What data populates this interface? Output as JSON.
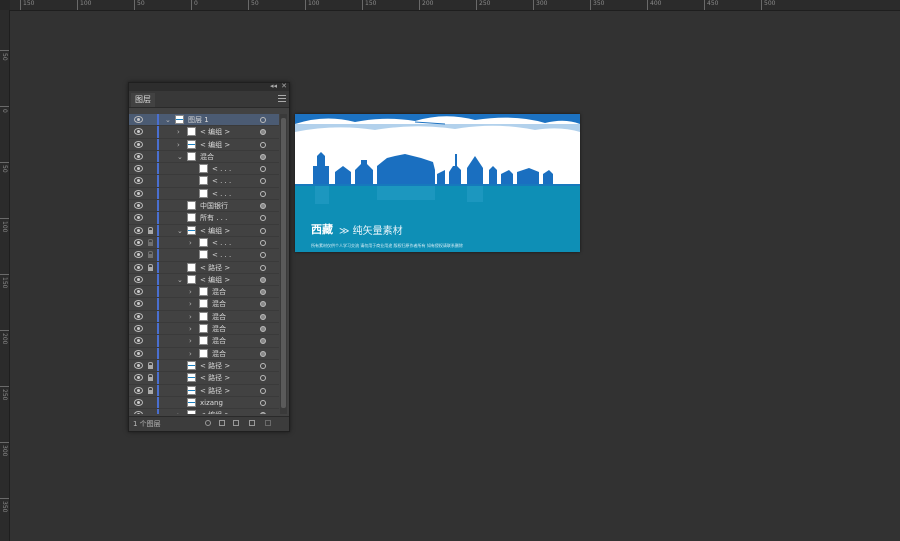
{
  "ruler": {
    "top_labels": [
      "150",
      "100",
      "50",
      "0",
      "50",
      "100",
      "150",
      "200",
      "250",
      "300",
      "350",
      "400",
      "450",
      "500"
    ],
    "left_labels": [
      "50",
      "0",
      "50",
      "100",
      "150",
      "200",
      "250",
      "300",
      "350"
    ]
  },
  "panel": {
    "collapse_glyph": "◂◂",
    "close_glyph": "✕",
    "tab_label": "图层",
    "footer_count": "1 个图层",
    "rows": [
      {
        "name": "图层 1",
        "arrow": "⌄",
        "indent": 0,
        "thumb": "pic",
        "lock": "none",
        "target": "empty",
        "selected": true
      },
      {
        "name": "< 编组 >",
        "arrow": "›",
        "indent": 1,
        "thumb": "white",
        "lock": "none",
        "target": "filled"
      },
      {
        "name": "< 编组 >",
        "arrow": "›",
        "indent": 1,
        "thumb": "pic",
        "lock": "none",
        "target": "empty"
      },
      {
        "name": "混合",
        "arrow": "⌄",
        "indent": 1,
        "thumb": "white",
        "lock": "none",
        "target": "filled"
      },
      {
        "name": "< . . .",
        "arrow": "",
        "indent": 2,
        "thumb": "white",
        "lock": "none",
        "target": "empty"
      },
      {
        "name": "< . . .",
        "arrow": "",
        "indent": 2,
        "thumb": "white",
        "lock": "none",
        "target": "empty"
      },
      {
        "name": "< . . .",
        "arrow": "",
        "indent": 2,
        "thumb": "white",
        "lock": "none",
        "target": "empty"
      },
      {
        "name": "中国银行",
        "arrow": "",
        "indent": 1,
        "thumb": "white",
        "lock": "none",
        "target": "filled"
      },
      {
        "name": "所有 . . .",
        "arrow": "",
        "indent": 1,
        "thumb": "white",
        "lock": "none",
        "target": "empty"
      },
      {
        "name": "< 编组 >",
        "arrow": "⌄",
        "indent": 1,
        "thumb": "pic",
        "lock": "lock",
        "target": "empty"
      },
      {
        "name": "< . . .",
        "arrow": "›",
        "indent": 2,
        "thumb": "white",
        "lock": "dim",
        "target": "empty"
      },
      {
        "name": "< . . .",
        "arrow": "",
        "indent": 2,
        "thumb": "white",
        "lock": "dim",
        "target": "empty"
      },
      {
        "name": "< 路径 >",
        "arrow": "",
        "indent": 1,
        "thumb": "white",
        "lock": "lock",
        "target": "empty"
      },
      {
        "name": "< 编组 >",
        "arrow": "⌄",
        "indent": 1,
        "thumb": "white",
        "lock": "none",
        "target": "filled"
      },
      {
        "name": "混合",
        "arrow": "›",
        "indent": 2,
        "thumb": "white",
        "lock": "none",
        "target": "filled"
      },
      {
        "name": "混合",
        "arrow": "›",
        "indent": 2,
        "thumb": "white",
        "lock": "none",
        "target": "filled"
      },
      {
        "name": "混合",
        "arrow": "›",
        "indent": 2,
        "thumb": "white",
        "lock": "none",
        "target": "filled"
      },
      {
        "name": "混合",
        "arrow": "›",
        "indent": 2,
        "thumb": "white",
        "lock": "none",
        "target": "filled"
      },
      {
        "name": "混合",
        "arrow": "›",
        "indent": 2,
        "thumb": "white",
        "lock": "none",
        "target": "filled"
      },
      {
        "name": "混合",
        "arrow": "›",
        "indent": 2,
        "thumb": "white",
        "lock": "none",
        "target": "filled"
      },
      {
        "name": "< 路径 >",
        "arrow": "",
        "indent": 1,
        "thumb": "pic",
        "lock": "lock",
        "target": "empty"
      },
      {
        "name": "< 路径 >",
        "arrow": "",
        "indent": 1,
        "thumb": "pic",
        "lock": "lock",
        "target": "empty"
      },
      {
        "name": "< 路径 >",
        "arrow": "",
        "indent": 1,
        "thumb": "pic",
        "lock": "lock",
        "target": "empty"
      },
      {
        "name": "xizang",
        "arrow": "",
        "indent": 1,
        "thumb": "pic",
        "lock": "none",
        "target": "empty"
      },
      {
        "name": "< 编组 >",
        "arrow": "›",
        "indent": 1,
        "thumb": "white",
        "lock": "none",
        "target": "filled"
      }
    ]
  },
  "artboard": {
    "title": "西藏",
    "subtitle": "≫ 纯矢量素材",
    "note": "所有素材仅供个人学习交流 请勿用于商业用途 版权归原作者所有 如有侵权请联系删除",
    "colors": {
      "sea": "#0e8fb6",
      "sky": "#ffffff",
      "skyline": "#1a6fc0"
    }
  },
  "icons": {
    "visibility": "eye-icon",
    "lock": "lock-icon",
    "target": "target-circle-icon",
    "expand": "chevron-icon",
    "panel_menu": "hamburger-menu-icon"
  }
}
